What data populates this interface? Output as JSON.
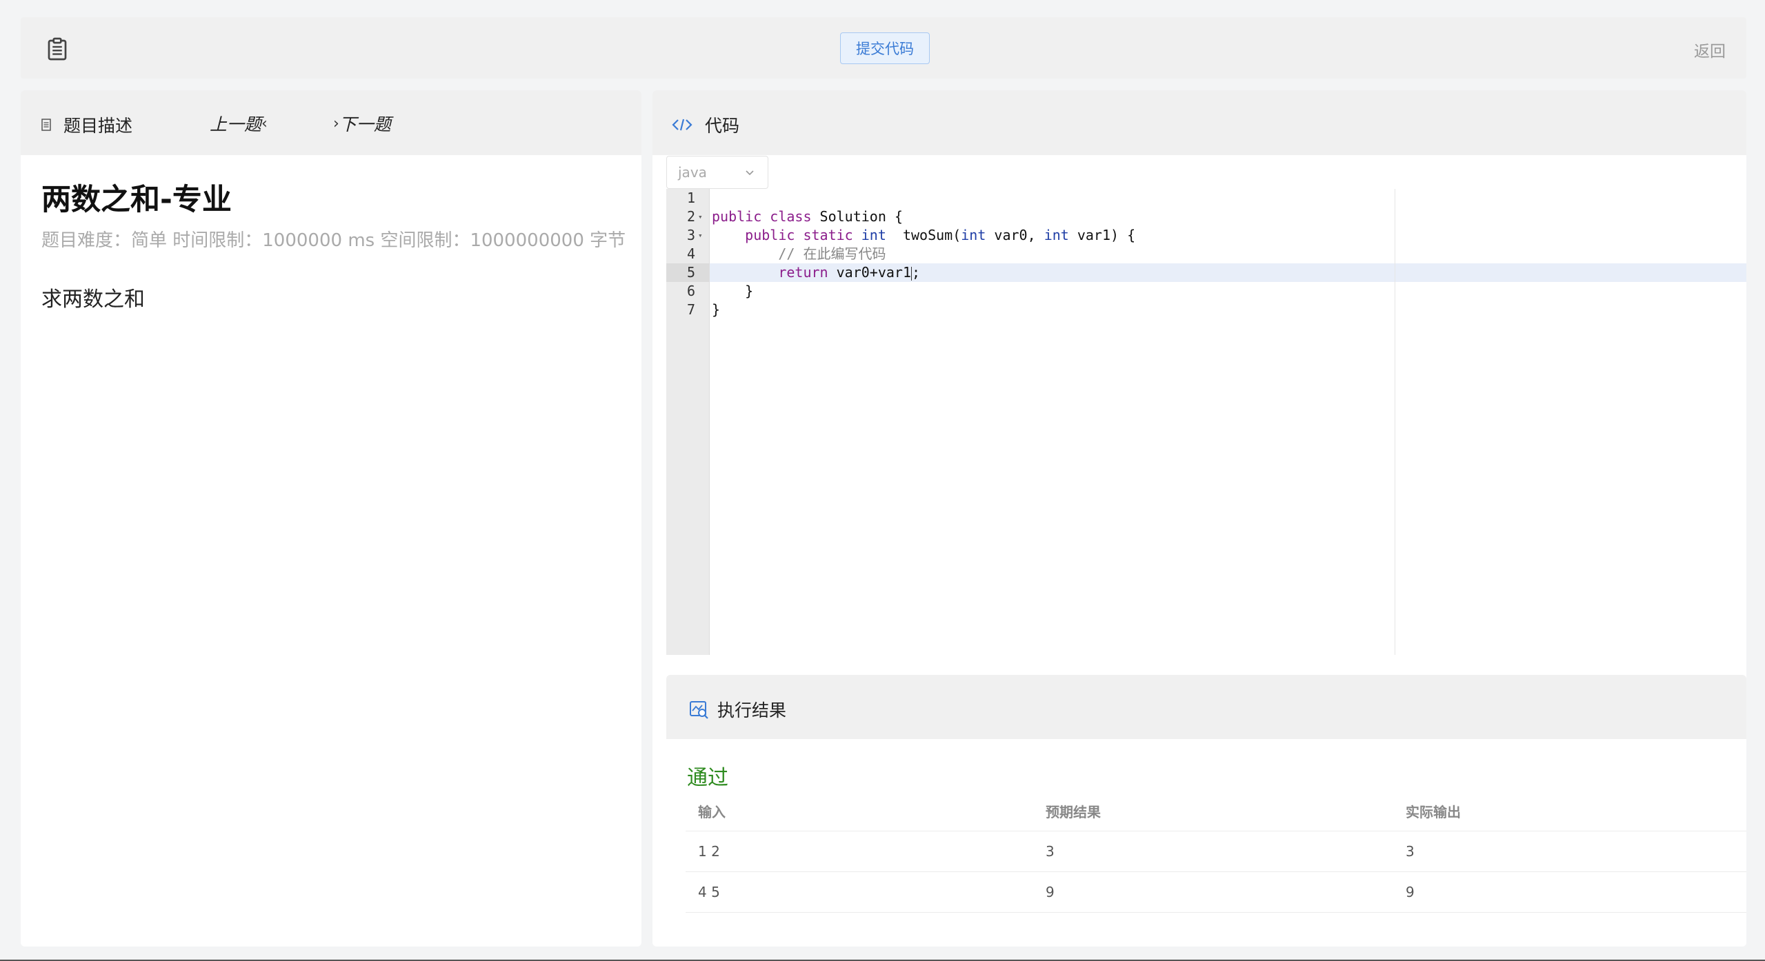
{
  "topbar": {
    "submit_label": "提交代码",
    "back_label": "返回"
  },
  "problem": {
    "tab_label": "题目描述",
    "prev_label": "上一题",
    "next_label": "下一题",
    "title": "两数之和-专业",
    "meta": "题目难度：简单 时间限制：1000000 ms 空间限制：1000000000 字节",
    "body": "求两数之和"
  },
  "editor": {
    "header_label": "代码",
    "language": "java",
    "line_numbers": [
      "1",
      "2",
      "3",
      "4",
      "5",
      "6",
      "7"
    ],
    "lines": [
      "",
      "public class Solution {",
      "    public static int  twoSum(int var0, int var1) {",
      "        // 在此编写代码",
      "        return var0+var1;",
      "    }",
      "}"
    ],
    "active_line": 5
  },
  "result": {
    "header_label": "执行结果",
    "status": "通过",
    "status_color": "#2e8b1f",
    "columns": [
      "输入",
      "预期结果",
      "实际输出"
    ],
    "rows": [
      [
        "1 2",
        "3",
        "3"
      ],
      [
        "4 5",
        "9",
        "9"
      ]
    ]
  },
  "colors": {
    "accent": "#3a7bd5",
    "keyword": "#8b1d8b",
    "type": "#1f3ea6",
    "comment": "#888888"
  },
  "icons": {
    "clipboard": "clipboard-icon",
    "doc": "doc-icon",
    "code": "code-icon",
    "result": "result-search-icon"
  }
}
